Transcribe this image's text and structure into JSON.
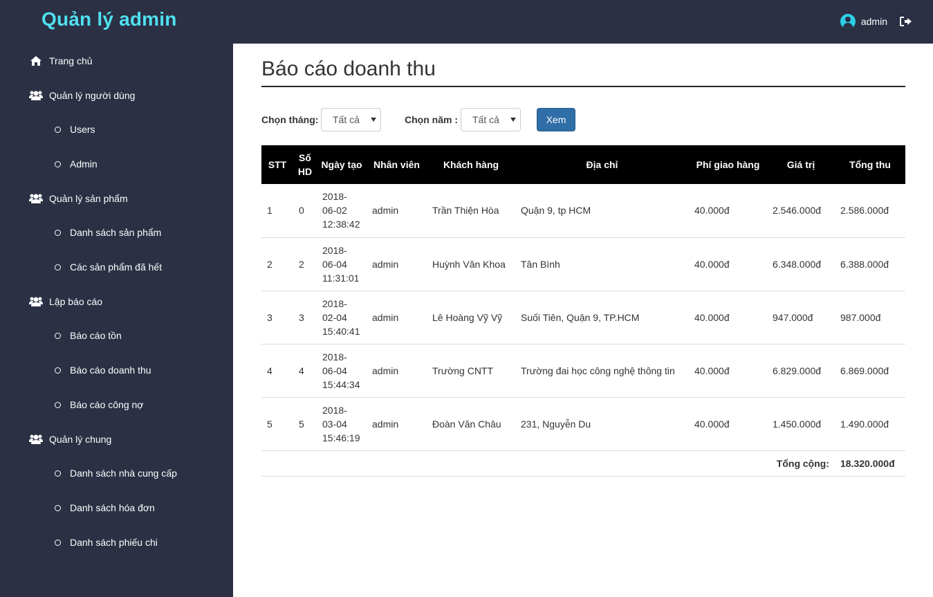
{
  "header": {
    "brand": "Quản lý admin",
    "username": "admin"
  },
  "icons": {
    "user": "user-circle-icon",
    "logout": "logout-icon",
    "home": "home-icon",
    "group": "users-icon",
    "bullet": "circle-icon"
  },
  "colors": {
    "brand": "#4fe0f0",
    "sidebar_bg": "#2b3044",
    "button": "#2f6ea6",
    "table_header_bg": "#000000"
  },
  "sidebar": {
    "home": "Trang chủ",
    "users_group": "Quản lý người dùng",
    "users_sub": [
      "Users",
      "Admin"
    ],
    "products_group": "Quản lý sản phẩm",
    "products_sub": [
      "Danh sách sản phẩm",
      "Các sản phẩm đã hết"
    ],
    "reports_group": "Lập báo cáo",
    "reports_sub": [
      "Báo cáo tồn",
      "Báo cáo doanh thu",
      "Báo cáo công nợ"
    ],
    "general_group": "Quản lý chung",
    "general_sub": [
      "Danh sách nhà cung cấp",
      "Danh sách hóa đơn",
      "Danh sách phiếu chi"
    ]
  },
  "page": {
    "title": "Báo cáo doanh thu"
  },
  "filters": {
    "month_label": "Chọn tháng:",
    "month_value": "Tất cả",
    "year_label": "Chọn năm :",
    "year_value": "Tất cả",
    "submit_label": "Xem"
  },
  "table": {
    "headers": [
      "STT",
      "Số HD",
      "Ngày tạo",
      "Nhân viên",
      "Khách hàng",
      "Địa chỉ",
      "Phí giao hàng",
      "Giá trị",
      "Tổng thu"
    ],
    "rows": [
      [
        "1",
        "0",
        "2018-06-02 12:38:42",
        "admin",
        "Trần Thiện Hòa",
        "Quận 9, tp HCM",
        "40.000đ",
        "2.546.000đ",
        "2.586.000đ"
      ],
      [
        "2",
        "2",
        "2018-06-04 11:31:01",
        "admin",
        "Huỳnh Văn Khoa",
        "Tân Bình",
        "40.000đ",
        "6.348.000đ",
        "6.388.000đ"
      ],
      [
        "3",
        "3",
        "2018-02-04 15:40:41",
        "admin",
        "Lê Hoàng Vỹ Vỹ",
        "Suối Tiên, Quận 9, TP.HCM",
        "40.000đ",
        "947.000đ",
        "987.000đ"
      ],
      [
        "4",
        "4",
        "2018-06-04 15:44:34",
        "admin",
        "Trường CNTT",
        "Trường đai học công nghệ thông tin",
        "40.000đ",
        "6.829.000đ",
        "6.869.000đ"
      ],
      [
        "5",
        "5",
        "2018-03-04 15:46:19",
        "admin",
        "Đoàn Văn Châu",
        "231, Nguyễn Du",
        "40.000đ",
        "1.450.000đ",
        "1.490.000đ"
      ]
    ],
    "total_label": "Tổng cộng:",
    "total_value": "18.320.000đ"
  }
}
